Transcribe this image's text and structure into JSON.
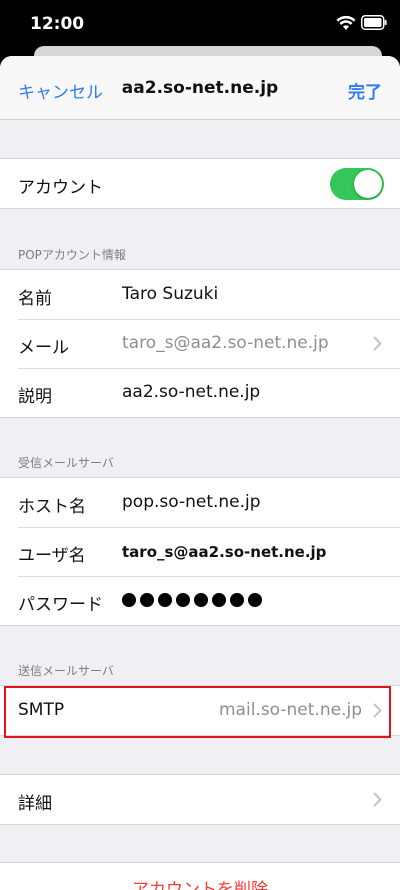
{
  "status_bar": {
    "time": "12:00"
  },
  "nav": {
    "cancel_label": "キャンセル",
    "title": "aa2.so-net.ne.jp",
    "done_label": "完了"
  },
  "account_toggle": {
    "label": "アカウント",
    "on": true
  },
  "pop_section": {
    "header": "POPアカウント情報",
    "name_label": "名前",
    "name_value": "Taro Suzuki",
    "mail_label": "メール",
    "mail_value": "taro_s@aa2.so-net.ne.jp",
    "desc_label": "説明",
    "desc_value": "aa2.so-net.ne.jp"
  },
  "incoming_section": {
    "header": "受信メールサーバ",
    "host_label": "ホスト名",
    "host_value": "pop.so-net.ne.jp",
    "user_label": "ユーザ名",
    "user_value": "taro_s@aa2.so-net.ne.jp",
    "password_label": "パスワード",
    "password_length": 8
  },
  "outgoing_section": {
    "header": "送信メールサーバ",
    "smtp_label": "SMTP",
    "smtp_value": "mail.so-net.ne.jp"
  },
  "advanced": {
    "label": "詳細"
  },
  "delete": {
    "label": "アカウントを削除"
  },
  "colors": {
    "accent": "#2f7bf5",
    "toggle_on": "#35c759",
    "destructive": "#ff3b30",
    "highlight": "#e0141e"
  }
}
